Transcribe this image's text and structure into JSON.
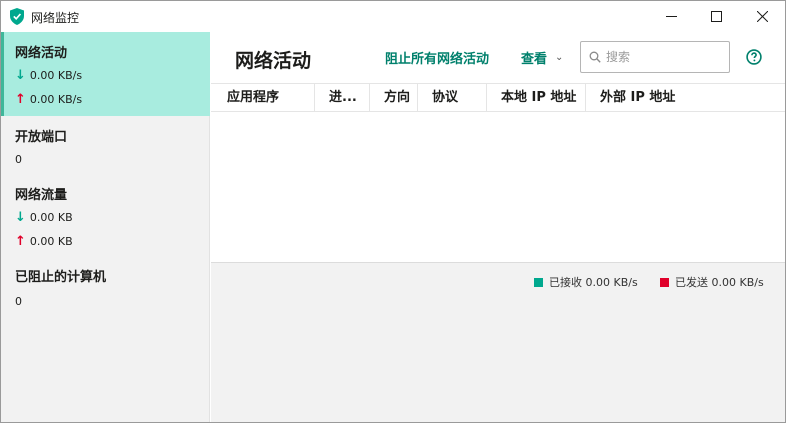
{
  "window": {
    "title": "网络监控",
    "controls": [
      "minimize",
      "maximize",
      "close"
    ]
  },
  "colors": {
    "accent": "#00806c",
    "active_bg": "#a8ecdf",
    "received": "#00a88e",
    "sent": "#e0002a"
  },
  "sidebar": {
    "network_activity": {
      "title": "网络活动",
      "down": "0.00 KB/s",
      "up": "0.00 KB/s"
    },
    "open_ports": {
      "title": "开放端口",
      "count": "0"
    },
    "network_traffic": {
      "title": "网络流量",
      "down": "0.00 KB",
      "up": "0.00 KB"
    },
    "blocked_computers": {
      "title": "已阻止的计算机",
      "count": "0"
    }
  },
  "main": {
    "title": "网络活动",
    "block_all": "阻止所有网络活动",
    "view_menu": "查看",
    "search_placeholder": "搜索",
    "columns": [
      "应用程序",
      "进...",
      "方向",
      "协议",
      "本地 IP 地址",
      "外部 IP 地址"
    ],
    "rows": []
  },
  "footer": {
    "received": "已接收 0.00 KB/s",
    "sent": "已发送 0.00 KB/s"
  }
}
